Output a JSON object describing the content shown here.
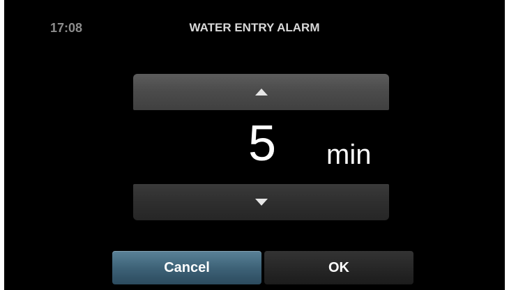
{
  "status": {
    "time": "17:08"
  },
  "screen": {
    "title": "WATER ENTRY ALARM"
  },
  "setting": {
    "value": "5",
    "unit": "min",
    "increase_icon": "triangle-up",
    "decrease_icon": "triangle-down"
  },
  "buttons": {
    "cancel_label": "Cancel",
    "ok_label": "OK"
  },
  "colors": {
    "cancel_accent": "#3e6378",
    "background": "#000000"
  }
}
